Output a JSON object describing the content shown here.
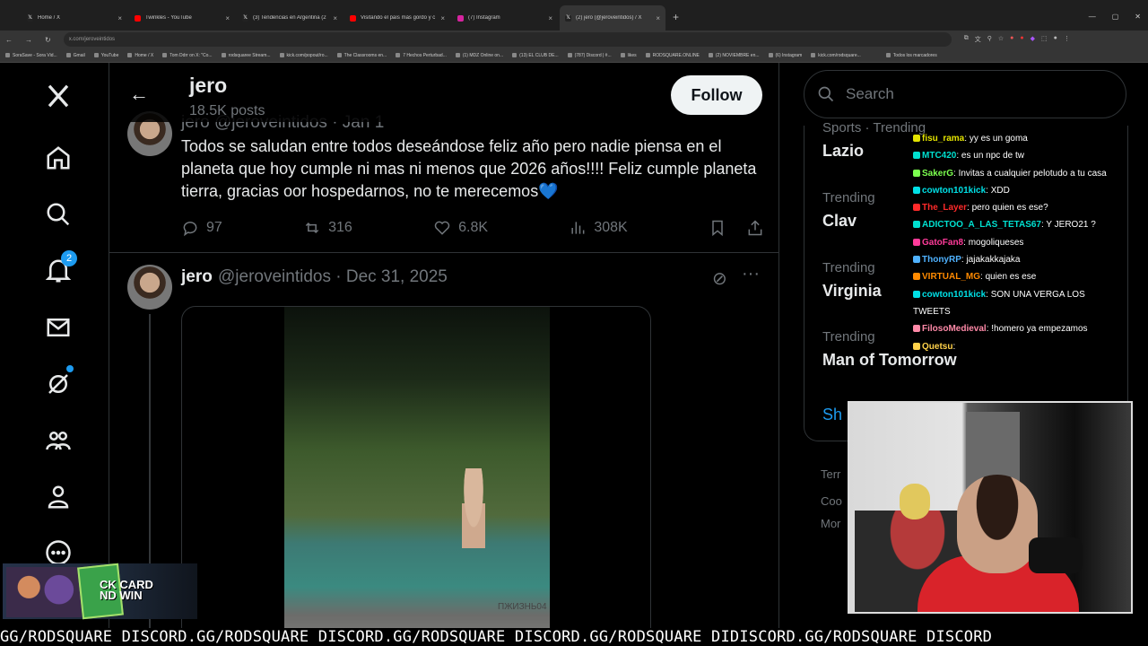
{
  "browser": {
    "tabs": [
      {
        "title": "Home / X",
        "icon": "x-icon",
        "color": "#222222"
      },
      {
        "title": "Twinkles - YouTube",
        "icon": "youtube-icon",
        "color": "#ff0000"
      },
      {
        "title": "(3) Tendencias en Argentina (2",
        "icon": "x-icon",
        "color": "#222222"
      },
      {
        "title": "Visitando el país más gordo y c",
        "icon": "youtube-icon",
        "color": "#ff0000"
      },
      {
        "title": "(7) Instagram",
        "icon": "instagram-icon",
        "color": "#d6249f"
      },
      {
        "title": "(2) jero (@jeroveintidos) / X",
        "icon": "x-icon",
        "color": "#222222"
      }
    ],
    "url": "x.com/jeroveintidos",
    "bookmarks": [
      "SoraSave - Sora Vid...",
      "Gmail",
      "YouTube",
      "Home / X",
      "Tom Ddrr on X: \"Co...",
      "rodsquaree Stream...",
      "kick.com/popout/ro...",
      "The Classrooms en...",
      "7 Hechos Perturbad...",
      "(1) MDZ Online on...",
      "(13) EL CLUB DE...",
      "(787) Discord | #...",
      "likes",
      "RODSQUARE.ONLINE",
      "(2) NOVIEMBRE en...",
      "(6) Instagram",
      "kick.com/rodsquare...",
      "Todos los marcadores"
    ]
  },
  "nav": {
    "notifications_badge": "2"
  },
  "profile": {
    "name": "jero",
    "posts": "18.5K posts",
    "follow_label": "Follow"
  },
  "tweet1": {
    "meta": "jero @jeroveintidos · Jan 1",
    "text": "Todos se saludan entre todos deseándose feliz año pero nadie piensa en el planeta que hoy cumple ni mas ni menos que 2026 años!!!! Feliz cumple planeta tierra, gracias oor hospedarnos, no te merecemos💙",
    "replies": "97",
    "reposts": "316",
    "likes": "6.8K",
    "views": "308K"
  },
  "tweet2": {
    "name": "jero",
    "handle": "@jeroveintidos · Dec 31, 2025",
    "watermark": "ПЖИЗНЬ04"
  },
  "right": {
    "search_placeholder": "Search",
    "trends": [
      {
        "label": "Sports · Trending",
        "topic": "Lazio"
      },
      {
        "label": "Trending",
        "topic": "Clav"
      },
      {
        "label": "Trending",
        "topic": "Virginia"
      },
      {
        "label": "Trending",
        "topic": "Man of Tomorrow"
      }
    ],
    "show_more": "Sh",
    "footer_1": "Terr",
    "footer_2": "Coo",
    "footer_3": "Mor"
  },
  "chat": [
    {
      "user": "fisu_rama",
      "msg": "yy es un goma",
      "color": "#e3e300"
    },
    {
      "user": "MTC420",
      "msg": "es un npc de tw",
      "color": "#00e0d0"
    },
    {
      "user": "SakerG",
      "msg": "Invitas a cualquier pelotudo a tu casa",
      "color": "#7cff4f"
    },
    {
      "user": "cowton101kick",
      "msg": "XDD",
      "color": "#00e0e6"
    },
    {
      "user": "The_Layer",
      "msg": "pero quien es ese?",
      "color": "#ff2a2a"
    },
    {
      "user": "ADICTOO_A_LAS_TETAS67",
      "msg": "Y JERO21 ?",
      "color": "#00e0d0"
    },
    {
      "user": "GatoFan8",
      "msg": "mogoliqueses",
      "color": "#ff3b9a"
    },
    {
      "user": "ThonyRP",
      "msg": "jajakakkajaka",
      "color": "#4fb2ff"
    },
    {
      "user": "VIRTUAL_MG",
      "msg": "quien es ese",
      "color": "#ff8a00"
    },
    {
      "user": "cowton101kick",
      "msg": "SON UNA VERGA LOS",
      "color": "#00e0e6"
    },
    {
      "user": "",
      "msg": "TWEETS",
      "color": "#ffffff"
    },
    {
      "user": "FilosoMedieval",
      "msg": "!homero ya empezamos",
      "color": "#ff8aa8"
    },
    {
      "user": "Quetsu",
      "msg": "",
      "color": "#ffd24a"
    }
  ],
  "ad": {
    "line1": "CK CARD",
    "line2": "ND WIN"
  },
  "ticker": "GG/RODSQUARE DISCORD.GG/RODSQUARE DISCORD.GG/RODSQUARE DISCORD.GG/RODSQUARE DIDISCORD.GG/RODSQUARE DISCORD"
}
